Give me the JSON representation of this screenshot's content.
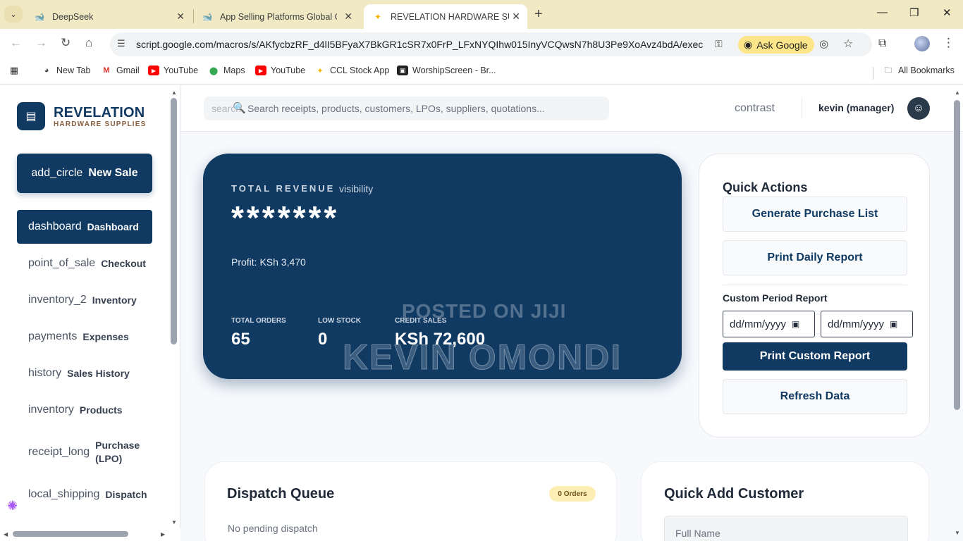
{
  "browser": {
    "tabs": [
      {
        "title": "DeepSeek",
        "active": false
      },
      {
        "title": "App Selling Platforms Global Gu",
        "active": false
      },
      {
        "title": "REVELATION HARDWARE SUPPL",
        "active": true
      }
    ],
    "url": "script.google.com/macros/s/AKfycbzRF_d4lI5BFyaX7BkGR1cSR7x0FrP_LFxNYQIhw015InyVCQwsN7h8U3Pe9XoAvz4bdA/exec",
    "ask_google_label": "Ask Google",
    "bookmarks": [
      {
        "label": "New Tab",
        "icon": "chrome-icon"
      },
      {
        "label": "Gmail",
        "icon": "gmail-icon"
      },
      {
        "label": "YouTube",
        "icon": "youtube-icon"
      },
      {
        "label": "Maps",
        "icon": "maps-icon"
      },
      {
        "label": "YouTube",
        "icon": "youtube-icon"
      },
      {
        "label": "CCL Stock App",
        "icon": "app-icon"
      },
      {
        "label": "WorshipScreen - Br...",
        "icon": "app-icon"
      }
    ],
    "all_bookmarks_label": "All Bookmarks"
  },
  "brand": {
    "name": "REVELATION",
    "subtitle": "HARDWARE SUPPLIES"
  },
  "new_sale": {
    "icon_text": "add_circle",
    "label": "New Sale"
  },
  "nav": [
    {
      "icon_text": "dashboard",
      "label": "Dashboard",
      "active": true
    },
    {
      "icon_text": "point_of_sale",
      "label": "Checkout"
    },
    {
      "icon_text": "inventory_2",
      "label": "Inventory"
    },
    {
      "icon_text": "payments",
      "label": "Expenses"
    },
    {
      "icon_text": "history",
      "label": "Sales History"
    },
    {
      "icon_text": "inventory",
      "label": "Products"
    },
    {
      "icon_text": "receipt_long",
      "label": "Purchase (LPO)"
    },
    {
      "icon_text": "local_shipping",
      "label": "Dispatch"
    }
  ],
  "topbar": {
    "search_icon_text": "search",
    "search_placeholder": "Search receipts, products, customers, LPOs, suppliers, quotations...",
    "contrast_label": "contrast",
    "user_label": "kevin (manager)"
  },
  "revenue": {
    "label": "TOTAL REVENUE",
    "visibility_text": "visibility",
    "value": "*******",
    "profit": "Profit: KSh 3,470",
    "stats": [
      {
        "label": "TOTAL ORDERS",
        "value": "65"
      },
      {
        "label": "LOW STOCK",
        "value": "0"
      },
      {
        "label": "CREDIT SALES",
        "value": "KSh 72,600"
      }
    ],
    "watermark_line1": "POSTED ON JIJI",
    "watermark_line2": "KEVIN OMONDI"
  },
  "quick_actions": {
    "title": "Quick Actions",
    "generate_label": "Generate Purchase List",
    "print_daily_label": "Print Daily Report",
    "custom_period_label": "Custom Period Report",
    "date_from_placeholder": "dd/mm/yyyy",
    "date_to_placeholder": "dd/mm/yyyy",
    "print_custom_label": "Print Custom Report",
    "refresh_label": "Refresh Data"
  },
  "dispatch": {
    "title": "Dispatch Queue",
    "badge": "0 Orders",
    "empty_text": "No pending dispatch"
  },
  "quick_add_customer": {
    "title": "Quick Add Customer",
    "full_name_placeholder": "Full Name"
  },
  "colors": {
    "primary": "#113a63",
    "brand_accent": "#8b5e3c",
    "badge_bg": "#fdeeb4",
    "tabbar": "#f1e9c4",
    "ask_google": "#fde68a"
  }
}
